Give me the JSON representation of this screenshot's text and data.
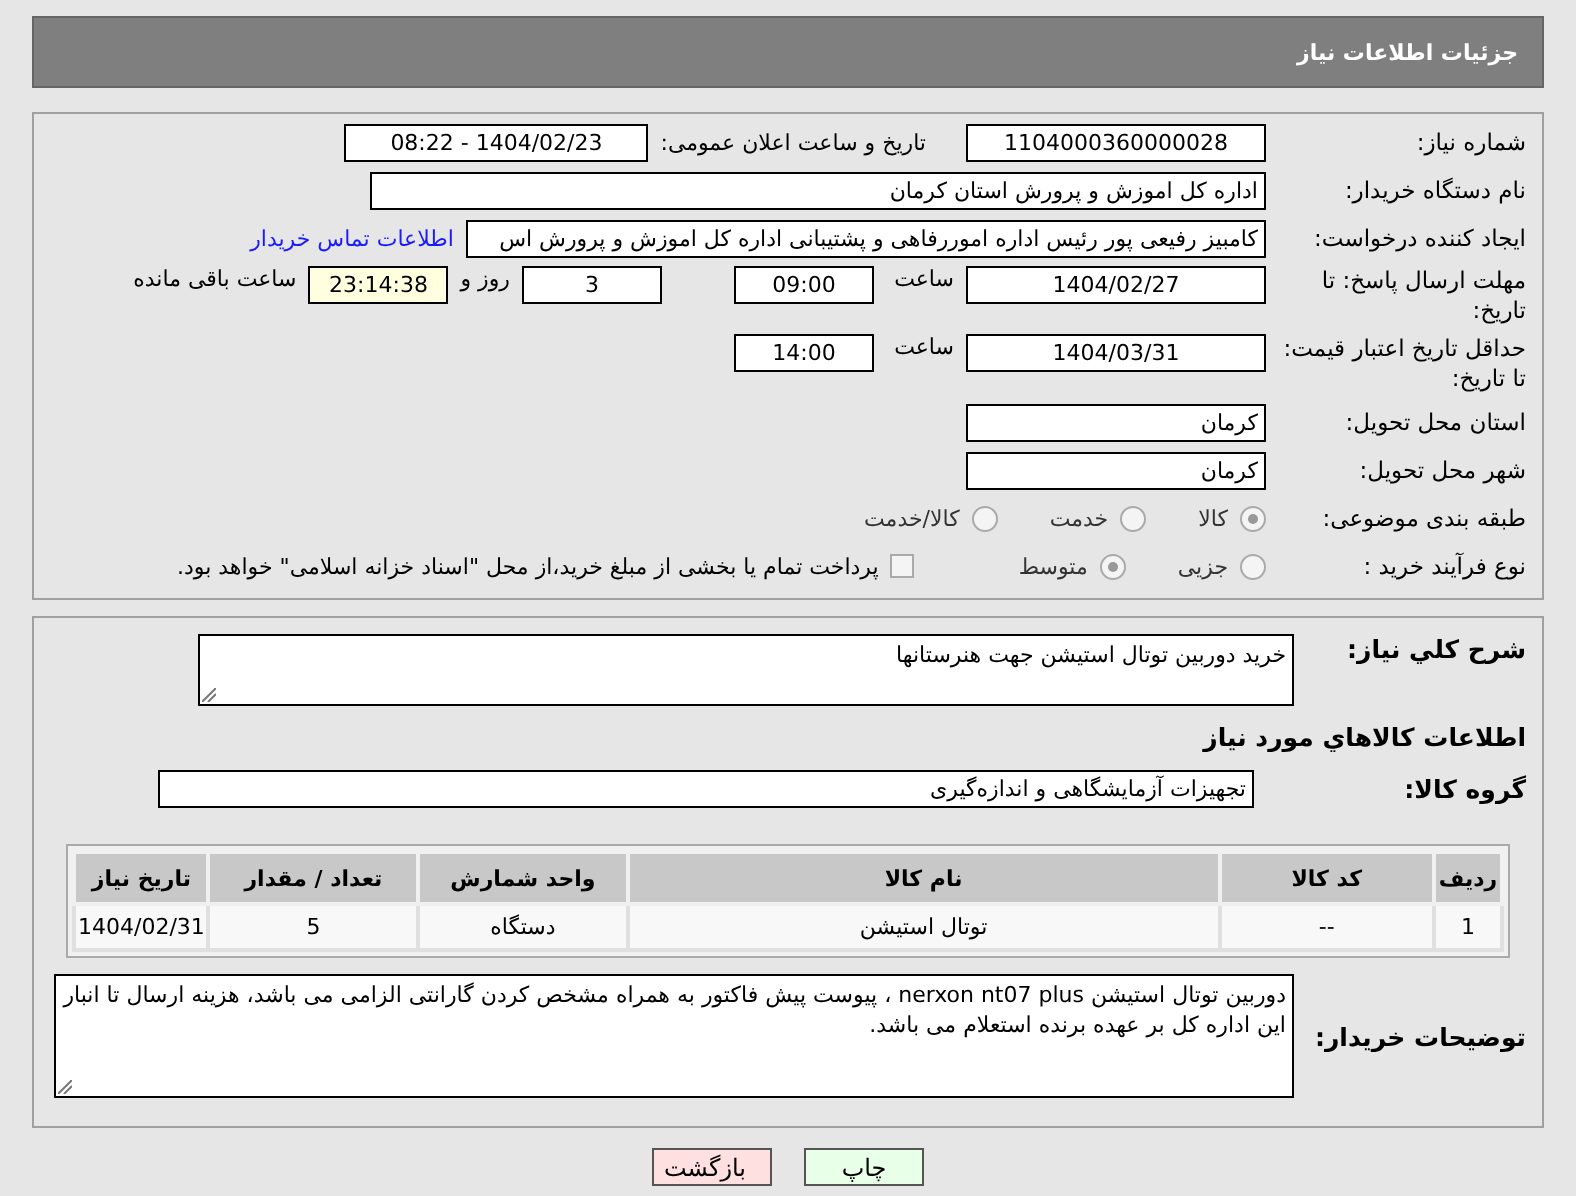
{
  "header": {
    "title": "جزئیات اطلاعات نیاز"
  },
  "details": {
    "need_number": {
      "label": "شماره نیاز:",
      "value": "1104000360000028"
    },
    "announce": {
      "label": "تاریخ و ساعت اعلان عمومی:",
      "value": "1404/02/23 - 08:22"
    },
    "buyer": {
      "label": "نام دستگاه خریدار:",
      "value": "اداره کل اموزش و پرورش استان کرمان"
    },
    "requester": {
      "label": "ایجاد کننده درخواست:",
      "value": "کامبیز رفیعی پور رئیس اداره اموررفاهی و پشتیبانی اداره کل اموزش و پرورش اس",
      "link": "اطلاعات تماس خریدار"
    },
    "deadline": {
      "label": "مهلت ارسال پاسخ: تا تاریخ:",
      "date": "1404/02/27",
      "time_label": "ساعت",
      "time": "09:00",
      "days": "3",
      "days_label": "روز و",
      "remaining": "23:14:38",
      "remaining_label": "ساعت باقی مانده"
    },
    "validity": {
      "label": "حداقل تاریخ اعتبار قیمت: تا تاریخ:",
      "date": "1404/03/31",
      "time_label": "ساعت",
      "time": "14:00"
    },
    "province": {
      "label": "استان محل تحویل:",
      "value": "کرمان"
    },
    "city": {
      "label": "شهر محل تحویل:",
      "value": "کرمان"
    },
    "category": {
      "label": "طبقه بندی موضوعی:",
      "options": [
        {
          "label": "کالا",
          "selected": true
        },
        {
          "label": "خدمت",
          "selected": false
        },
        {
          "label": "کالا/خدمت",
          "selected": false
        }
      ]
    },
    "process": {
      "label": "نوع فرآیند خرید :",
      "options": [
        {
          "label": "جزیی",
          "selected": false
        },
        {
          "label": "متوسط",
          "selected": true
        }
      ],
      "payment": {
        "label": "پرداخت تمام یا بخشی از مبلغ خرید،از محل \"اسناد خزانه اسلامی\" خواهد بود.",
        "checked": false
      }
    }
  },
  "summary": {
    "label": "شرح كلي نياز:",
    "value": "خرید دوربین توتال استیشن جهت هنرستانها"
  },
  "goods_title": "اطلاعات كالاهاي مورد نياز",
  "goods_group": {
    "label": "گروه کالا:",
    "value": "تجهیزات آزمایشگاهی و اندازه‌گیری"
  },
  "table": {
    "columns": [
      "ردیف",
      "کد کالا",
      "نام کالا",
      "واحد شمارش",
      "تعداد / مقدار",
      "تاریخ نیاز"
    ],
    "rows": [
      [
        "1",
        "--",
        "توتال استیشن",
        "دستگاه",
        "5",
        "1404/02/31"
      ]
    ]
  },
  "buyer_notes": {
    "label": "توضیحات خریدار:",
    "value": "دوربین توتال استیشن nerxon nt07 plus ، پیوست پیش فاکتور به همراه مشخص کردن گارانتی الزامی می باشد، هزینه ارسال تا انبار این اداره کل بر عهده برنده استعلام می باشد."
  },
  "buttons": [
    {
      "label": "چاپ",
      "kind": "print"
    },
    {
      "label": "بازگشت",
      "kind": "back"
    }
  ]
}
